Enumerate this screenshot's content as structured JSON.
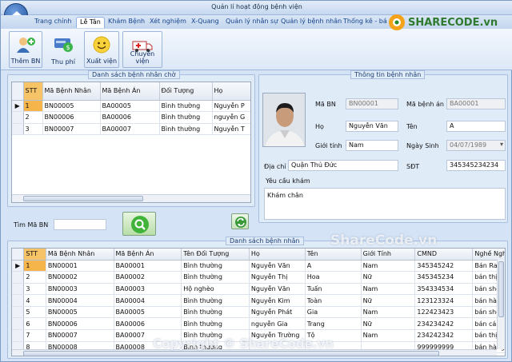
{
  "window": {
    "title": "Quản lí hoạt động bệnh viện"
  },
  "tabs": [
    "Trang chính",
    "Lễ Tân",
    "Khám Bệnh",
    "Xét nghiệm",
    "X-Quang",
    "Quản lý nhân sự",
    "Quản lý bệnh nhân",
    "Thống kê - bá"
  ],
  "toolbar": {
    "add_patient": "Thêm BN",
    "fee": "Thu phí",
    "discharge": "Xuất viện",
    "transfer": "Chuyển viện"
  },
  "waiting_list": {
    "title": "Danh sách bệnh nhân chờ",
    "columns": [
      "STT",
      "Mã Bệnh Nhân",
      "Mã Bệnh Án",
      "Đối Tượng",
      "Họ"
    ],
    "rows": [
      [
        "1",
        "BN00005",
        "BA00005",
        "Bình thường",
        "Nguyễn P"
      ],
      [
        "2",
        "BN00006",
        "BA00006",
        "Bình thường",
        "nguyễn G"
      ],
      [
        "3",
        "BN00007",
        "BA00007",
        "Bình thường",
        "Nguyễn T"
      ]
    ]
  },
  "patient_info": {
    "title": "Thông tin bệnh nhân",
    "id_label": "Mã BN",
    "id_value": "BN00001",
    "record_label": "Mã bệnh án",
    "record_value": "BA00001",
    "last_label": "Họ",
    "last_value": "Nguyễn Văn",
    "first_label": "Tên",
    "first_value": "A",
    "gender_label": "Giới tính",
    "gender_value": "Nam",
    "dob_label": "Ngày Sinh",
    "dob_value": "04/07/1989",
    "address_label": "Địa chỉ",
    "address_value": "Quận Thủ Đức",
    "phone_label": "SĐT",
    "phone_value": "345345234234",
    "request_label": "Yêu cầu khám",
    "request_value": "Khám chân"
  },
  "search": {
    "label": "Tìm Mã BN",
    "value": ""
  },
  "patient_list": {
    "title": "Danh sách bệnh nhân",
    "columns": [
      "STT",
      "Mã Bệnh Nhân",
      "Mã Bệnh Án",
      "Tên Đối Tượng",
      "Họ",
      "Tên",
      "Giới Tính",
      "CMND",
      "Nghề Nghiệ"
    ],
    "rows": [
      [
        "1",
        "BN00001",
        "BA00001",
        "Bình thường",
        "Nguyễn Văn",
        "A",
        "Nam",
        "345345242",
        "Bán Rau"
      ],
      [
        "2",
        "BN00002",
        "BA00002",
        "Bình thường",
        "Nguyễn Thị",
        "Hoa",
        "Nữ",
        "345345234",
        "bán thịt"
      ],
      [
        "3",
        "BN00003",
        "BA00003",
        "Hộ nghèo",
        "Nguyễn Văn",
        "Tuấn",
        "Nam",
        "354334534",
        "bán shop"
      ],
      [
        "4",
        "BN00004",
        "BA00004",
        "Bình thường",
        "Nguyễn Kim",
        "Toàn",
        "Nữ",
        "123123324",
        "bán hàng"
      ],
      [
        "5",
        "BN00005",
        "BA00005",
        "Bình thường",
        "Nguyễn Phát",
        "Gia",
        "Nam",
        "122423423",
        "bán shop th"
      ],
      [
        "6",
        "BN00006",
        "BA00006",
        "Bình thường",
        "nguyễn Gia",
        "Trang",
        "Nữ",
        "234234242",
        "bán cá"
      ],
      [
        "7",
        "BN00007",
        "BA00007",
        "Bình thường",
        "Nguyễn Trường",
        "Tộ",
        "Nam",
        "234242342",
        "bán thịt"
      ],
      [
        "8",
        "BN00008",
        "BA00008",
        "Bình thường",
        "",
        "",
        "",
        "999999999",
        "bán hàng r"
      ]
    ]
  },
  "watermarks": {
    "logo": "SHARECODE.vn",
    "center": "ShareCode.vn",
    "footer": "Copyright © ShareCode.vn"
  },
  "colors": {
    "accent": "#f6b54a",
    "ribbon": "#dce8f7",
    "header": "#15428b"
  }
}
